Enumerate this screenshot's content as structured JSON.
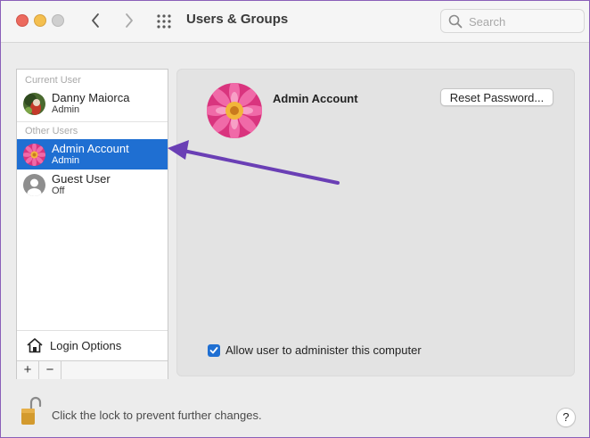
{
  "window": {
    "title": "Users & Groups",
    "search": {
      "placeholder": "Search",
      "value": ""
    }
  },
  "sidebar": {
    "current_user_label": "Current User",
    "other_users_label": "Other Users",
    "users": [
      {
        "name": "Danny Maiorca",
        "role": "Admin",
        "selected": false
      },
      {
        "name": "Admin Account",
        "role": "Admin",
        "selected": true
      },
      {
        "name": "Guest User",
        "role": "Off",
        "selected": false
      }
    ],
    "login_options_label": "Login Options",
    "add_label": "+",
    "remove_label": "−"
  },
  "panel": {
    "account_name": "Admin Account",
    "reset_password_label": "Reset Password...",
    "allow_admin_label": "Allow user to administer this computer",
    "allow_admin_checked": true
  },
  "footer": {
    "lock_text": "Click the lock to prevent further changes.",
    "help_label": "?"
  },
  "icons": {
    "close": "close-button-icon",
    "minimize": "minimize-button-icon",
    "zoom": "zoom-button-icon",
    "back": "chevron-left-icon",
    "forward": "chevron-right-icon",
    "show_all": "grid-icon",
    "search": "magnifying-glass-icon",
    "house": "house-icon",
    "lock": "padlock-open-icon"
  },
  "colors": {
    "selection": "#1f6fd2",
    "annotation_arrow": "#6a3fb5"
  }
}
